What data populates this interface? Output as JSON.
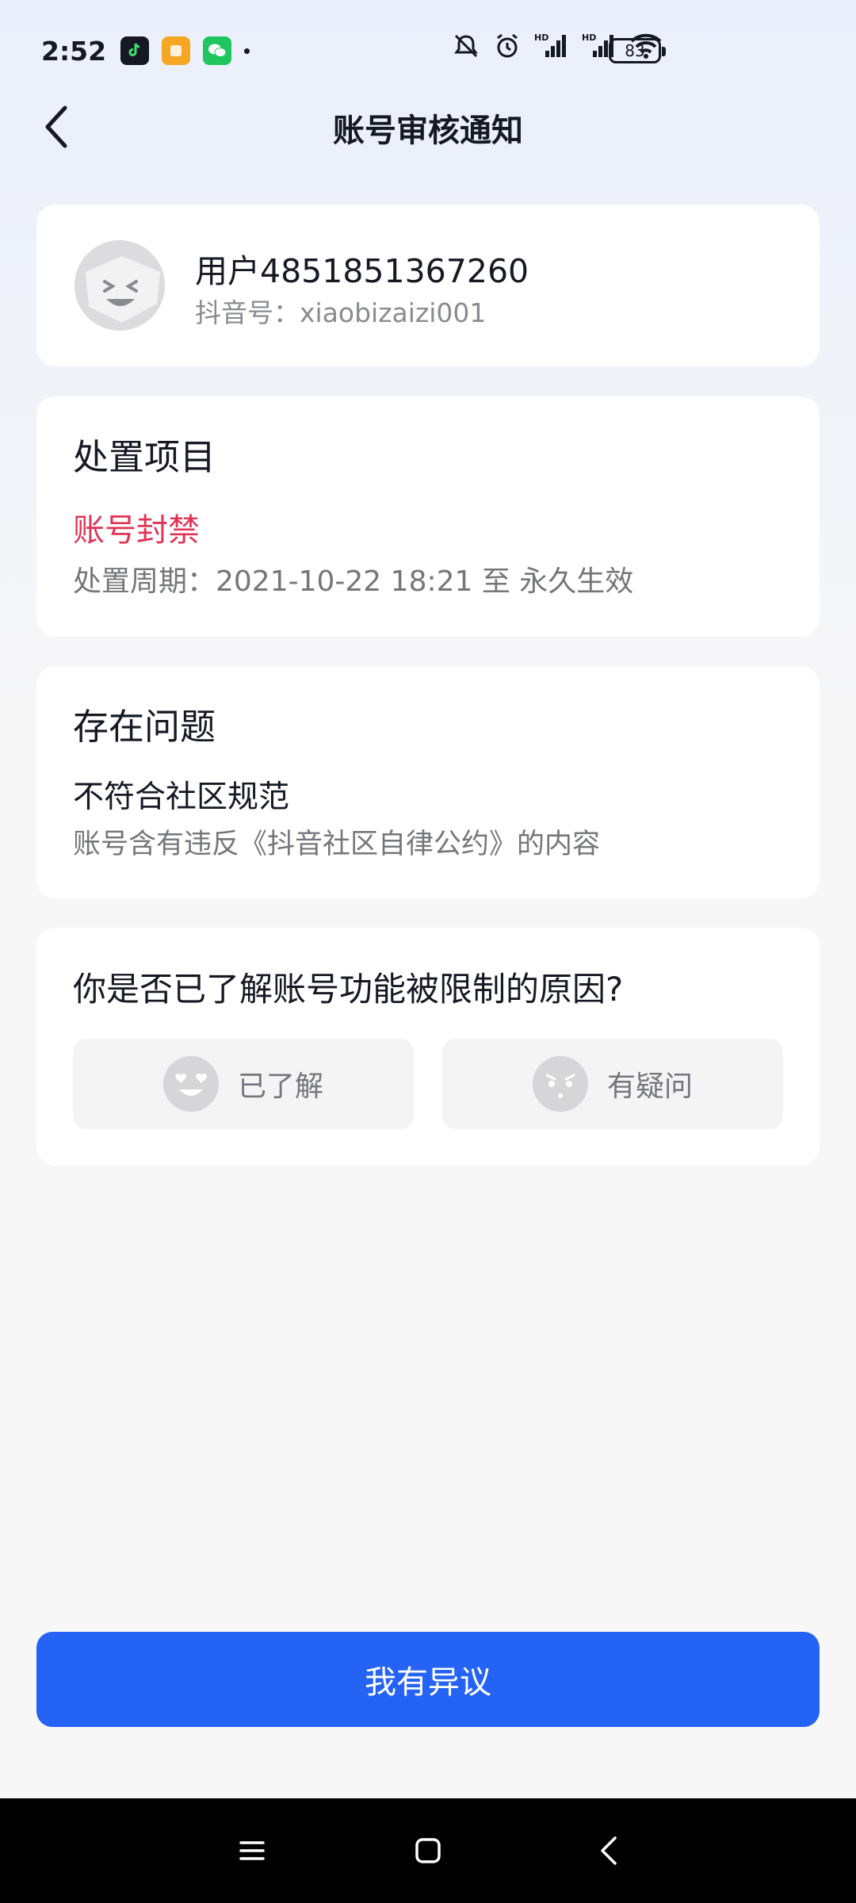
{
  "status_bar": {
    "time": "2:52",
    "battery": "83",
    "icons": [
      "douyin-lite-icon",
      "notes-icon",
      "wechat-icon",
      "mute-icon",
      "alarm-icon",
      "hd-signal-icon",
      "hd-signal-icon",
      "wifi-icon",
      "battery-icon"
    ]
  },
  "header": {
    "title": "账号审核通知"
  },
  "user": {
    "name": "用户4851851367260",
    "douyin_id": "抖音号：xiaobizaizi001"
  },
  "action": {
    "title": "处置项目",
    "label": "账号封禁",
    "period": "处置周期：2021-10-22 18:21 至 永久生效"
  },
  "problem": {
    "title": "存在问题",
    "main": "不符合社区规范",
    "desc": "账号含有违反《抖音社区自律公约》的内容"
  },
  "feedback": {
    "question": "你是否已了解账号功能被限制的原因?",
    "understood_label": "已了解",
    "doubt_label": "有疑问"
  },
  "objection": {
    "label": "我有异议"
  },
  "colors": {
    "accent": "#2563f5",
    "alert": "#e03457"
  }
}
